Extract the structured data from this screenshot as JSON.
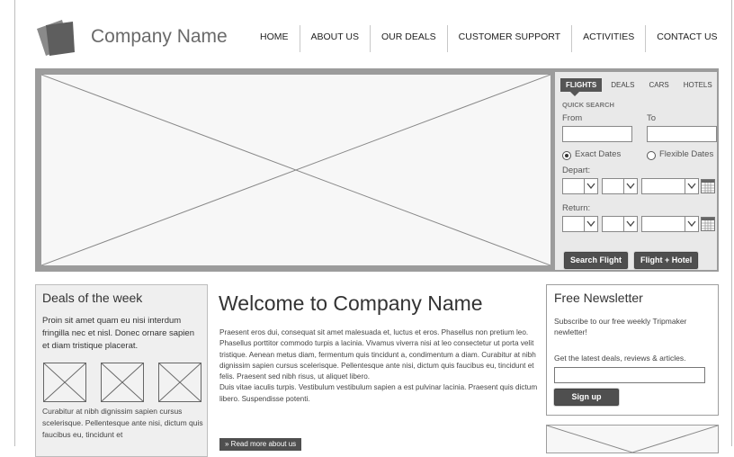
{
  "header": {
    "company_name": "Company Name",
    "nav": [
      "HOME",
      "ABOUT US",
      "OUR DEALS",
      "CUSTOMER SUPPORT",
      "ACTIVITIES",
      "CONTACT US"
    ]
  },
  "search": {
    "tabs": [
      "FLIGHTS",
      "DEALS",
      "CARS",
      "HOTELS"
    ],
    "active_tab": "FLIGHTS",
    "quick_search": "QUICK SEARCH",
    "from_label": "From",
    "to_label": "To",
    "exact_dates": "Exact Dates",
    "flexible_dates": "Flexible Dates",
    "depart_label": "Depart:",
    "return_label": "Return:",
    "search_flight_button": "Search Flight",
    "flight_hotel_button": "Flight + Hotel"
  },
  "deals": {
    "title": "Deals of the week",
    "intro": "Proin sit amet quam eu nisi interdum fringilla nec et nisl. Donec ornare sapien et diam tristique placerat.",
    "more": "Curabitur at nibh dignissim sapien cursus scelerisque. Pellentesque ante nisi, dictum quis faucibus eu, tincidunt et"
  },
  "main": {
    "title": "Welcome to Company Name",
    "paragraph1": "Praesent eros dui, consequat sit amet malesuada et, luctus et eros. Phasellus non pretium leo. Phasellus porttitor commodo turpis a lacinia. Vivamus viverra nisi at leo consectetur ut porta velit tristique. Aenean metus diam, fermentum quis tincidunt a, condimentum a diam. Curabitur at nibh dignissim sapien cursus scelerisque. Pellentesque ante nisi, dictum quis faucibus eu, tincidunt et felis. Praesent sed nibh risus, ut aliquet libero.",
    "paragraph2": "Duis vitae iaculis turpis. Vestibulum vestibulum sapien a est pulvinar lacinia. Praesent quis dictum libero. Suspendisse potenti.",
    "read_more": "» Read more about us"
  },
  "newsletter": {
    "title": "Free Newsletter",
    "text1": "Subscribe to our free weekly Tripmaker newletter!",
    "text2": "Get the latest deals, reviews & articles.",
    "signup_button": "Sign up"
  }
}
